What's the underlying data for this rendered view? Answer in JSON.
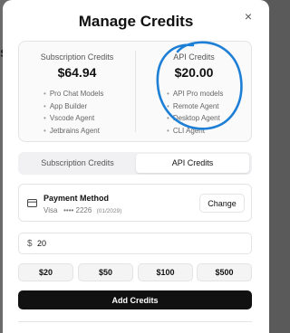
{
  "backdrop": {
    "peek_letter": "s"
  },
  "modal": {
    "title": "Manage Credits",
    "close_icon": "×"
  },
  "plans": [
    {
      "name": "Subscription Credits",
      "price": "$64.94",
      "features": [
        "Pro Chat Models",
        "App Builder",
        "Vscode Agent",
        "Jetbrains Agent"
      ]
    },
    {
      "name": "API Credits",
      "price": "$20.00",
      "features": [
        "API Pro models",
        "Remote Agent",
        "Desktop Agent",
        "CLI Agent"
      ]
    }
  ],
  "annotation": {
    "circle_color": "#1e7fd6"
  },
  "tabs": [
    {
      "label": "Subscription Credits",
      "active": false
    },
    {
      "label": "API Credits",
      "active": true
    }
  ],
  "payment": {
    "title": "Payment Method",
    "brand": "Visa",
    "masked": "•••• 2226",
    "expiry": "(01/2029)",
    "change_label": "Change",
    "icon": "credit-card-icon"
  },
  "amount": {
    "currency_symbol": "$",
    "value": "20"
  },
  "presets": [
    "$20",
    "$50",
    "$100",
    "$500"
  ],
  "add_button": {
    "label": "Add Credits"
  }
}
